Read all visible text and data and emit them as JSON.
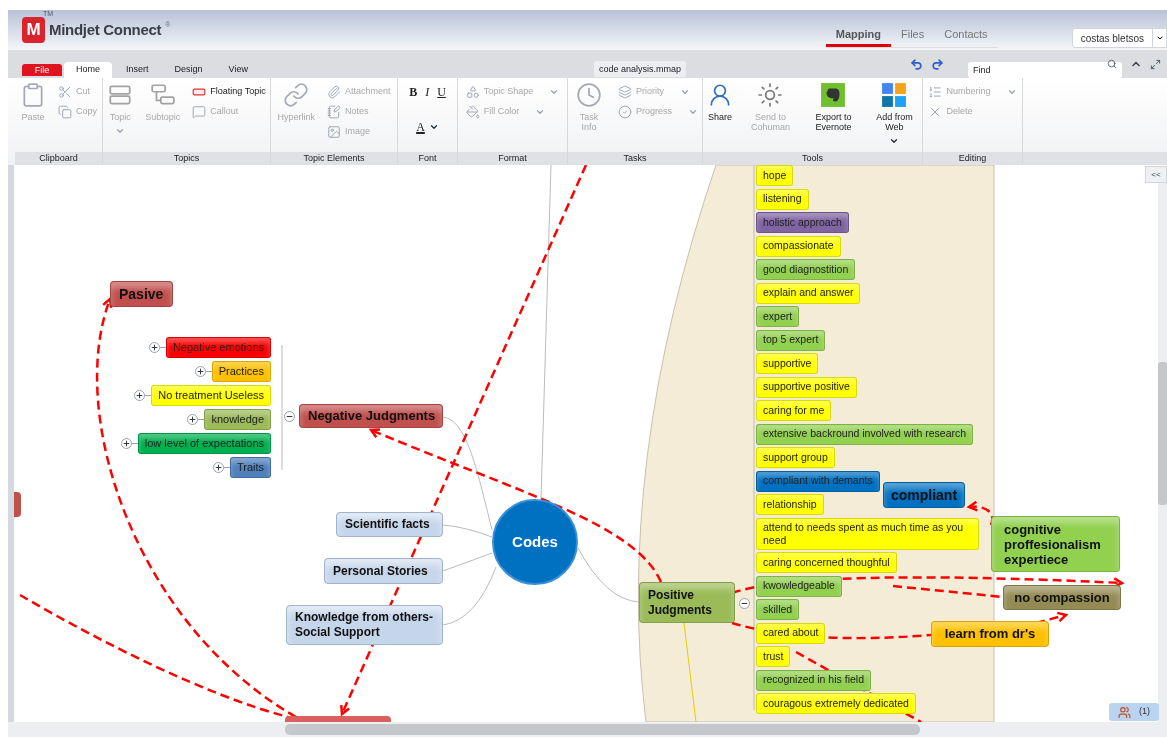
{
  "app": {
    "logo_mark": "M",
    "tm": "TM",
    "name": "Mindjet Connect",
    "registered": "®"
  },
  "nav_tabs": [
    {
      "label": "Mapping",
      "selected": true
    },
    {
      "label": "Files",
      "selected": false
    },
    {
      "label": "Contacts",
      "selected": false
    }
  ],
  "user": "costas bletsos",
  "ribbon_tabs": [
    {
      "label": "File",
      "kind": "file",
      "selected": false
    },
    {
      "label": "Home",
      "kind": "tab",
      "selected": true
    },
    {
      "label": "Insert",
      "kind": "tab",
      "selected": false
    },
    {
      "label": "Design",
      "kind": "tab",
      "selected": false
    },
    {
      "label": "View",
      "kind": "tab",
      "selected": false
    }
  ],
  "document_tab": "code analysis.mmap",
  "find": {
    "placeholder": "Find"
  },
  "ribbon_groups": [
    {
      "label": "Clipboard",
      "tools": [
        {
          "label": "Paste",
          "kind": "large",
          "disabled": true,
          "dropdown": false
        },
        {
          "label": "Cut",
          "kind": "small",
          "disabled": true,
          "dropdown": false
        },
        {
          "label": "Copy",
          "kind": "small",
          "disabled": true,
          "dropdown": false
        }
      ]
    },
    {
      "label": "Topics",
      "tools": [
        {
          "label": "Topic",
          "kind": "large",
          "disabled": true,
          "dropdown": true
        },
        {
          "label": "Subtopic",
          "kind": "large",
          "disabled": true,
          "dropdown": false
        },
        {
          "label": "Floating Topic",
          "kind": "small",
          "disabled": false,
          "dropdown": false
        },
        {
          "label": "Callout",
          "kind": "small",
          "disabled": true,
          "dropdown": false
        }
      ]
    },
    {
      "label": "Topic Elements",
      "tools": [
        {
          "label": "Hyperlink",
          "kind": "large",
          "disabled": true,
          "dropdown": false
        },
        {
          "label": "Attachment",
          "kind": "small",
          "disabled": true,
          "dropdown": false
        },
        {
          "label": "Notes",
          "kind": "small",
          "disabled": true,
          "dropdown": false
        },
        {
          "label": "Image",
          "kind": "small",
          "disabled": true,
          "dropdown": false
        }
      ]
    },
    {
      "label": "Font",
      "tools": [
        {
          "label": "B",
          "kind": "bold",
          "disabled": false,
          "dropdown": false
        },
        {
          "label": "I",
          "kind": "italic",
          "disabled": false,
          "dropdown": false
        },
        {
          "label": "U",
          "kind": "underline",
          "disabled": false,
          "dropdown": false
        },
        {
          "label": "A",
          "kind": "text_color",
          "disabled": false,
          "dropdown": true
        }
      ]
    },
    {
      "label": "Format",
      "tools": [
        {
          "label": "Topic Shape",
          "kind": "small",
          "disabled": true,
          "dropdown": true
        },
        {
          "label": "Fill Color",
          "kind": "small",
          "disabled": true,
          "dropdown": true
        }
      ]
    },
    {
      "label": "Tasks",
      "tools": [
        {
          "label": "Task Info",
          "kind": "large",
          "disabled": true,
          "dropdown": false
        },
        {
          "label": "Priority",
          "kind": "small",
          "disabled": true,
          "dropdown": true
        },
        {
          "label": "Progress",
          "kind": "small",
          "disabled": true,
          "dropdown": true
        }
      ]
    },
    {
      "label": "Tools",
      "tools": [
        {
          "label": "Share",
          "kind": "large",
          "disabled": false,
          "dropdown": false
        },
        {
          "label": "Send to Cohuman",
          "kind": "large",
          "disabled": true,
          "dropdown": false
        },
        {
          "label": "Export to Evernote",
          "kind": "large",
          "disabled": false,
          "dropdown": false
        },
        {
          "label": "Add from Web",
          "kind": "large",
          "disabled": false,
          "dropdown": true
        }
      ]
    },
    {
      "label": "Editing",
      "tools": [
        {
          "label": "Numbering",
          "kind": "small",
          "disabled": true,
          "dropdown": true
        },
        {
          "label": "Delete",
          "kind": "small",
          "disabled": true,
          "dropdown": false
        }
      ]
    }
  ],
  "collapse_button": "<<",
  "map": {
    "central_topic": "Codes",
    "negative": {
      "label": "Negative Judgments",
      "color": "#c0504d",
      "expanded": true,
      "children": [
        {
          "label": "Negative emotions",
          "color": "#ff0000",
          "expanded": false
        },
        {
          "label": "Practices",
          "color": "#ffc000",
          "expanded": false
        },
        {
          "label": "No treatment Useless",
          "color": "#ffff00",
          "expanded": false
        },
        {
          "label": "knowledge",
          "color": "#9bbb59",
          "expanded": false
        },
        {
          "label": "low level of expectations",
          "color": "#00b050",
          "expanded": false
        },
        {
          "label": "Traits",
          "color": "#4f81bd",
          "expanded": false
        }
      ]
    },
    "branches": [
      {
        "label": "Scientific facts"
      },
      {
        "label": "Personal Stories"
      },
      {
        "label": "Knowledge from others-Social Support"
      }
    ],
    "positive": {
      "label": "Positive Judgments",
      "color": "#9bbb59",
      "expanded": true,
      "children": [
        {
          "label": "hope",
          "color": "#ffff00"
        },
        {
          "label": "listening",
          "color": "#ffff00"
        },
        {
          "label": "holistic approach",
          "color": "#8064a2"
        },
        {
          "label": "compassionate",
          "color": "#ffff00"
        },
        {
          "label": "good diagnostition",
          "color": "#92d050"
        },
        {
          "label": "explain and answer",
          "color": "#ffff00"
        },
        {
          "label": "expert",
          "color": "#92d050"
        },
        {
          "label": "top 5 expert",
          "color": "#92d050"
        },
        {
          "label": "supportive",
          "color": "#ffff00"
        },
        {
          "label": "supportive positive",
          "color": "#ffff00"
        },
        {
          "label": "caring for me",
          "color": "#ffff00"
        },
        {
          "label": "extensive backround involved with research",
          "color": "#92d050"
        },
        {
          "label": "support group",
          "color": "#ffff00"
        },
        {
          "label": "compliant with demants",
          "color": "#0070c0"
        },
        {
          "label": "relationship",
          "color": "#ffff00"
        },
        {
          "label": "attend to needs spent as much time as you need",
          "color": "#ffff00"
        },
        {
          "label": "caring concerned thoughful",
          "color": "#ffff00"
        },
        {
          "label": "kwowledgeable",
          "color": "#92d050"
        },
        {
          "label": "skilled",
          "color": "#92d050"
        },
        {
          "label": "cared about",
          "color": "#ffff00"
        },
        {
          "label": "trust",
          "color": "#ffff00"
        },
        {
          "label": "recognized in his field",
          "color": "#92d050"
        },
        {
          "label": "couragous extremely dedicated",
          "color": "#ffff00"
        }
      ]
    },
    "floating": [
      {
        "label": "Pasive",
        "color": "#c0504d"
      },
      {
        "label": "compliant",
        "color": "#0070c0"
      },
      {
        "label": "cognitive proffesionalism expertiece",
        "color": "#92d050"
      },
      {
        "label": "no compassion",
        "color": "#948a54"
      },
      {
        "label": "learn from dr's",
        "color": "#ffc000"
      }
    ]
  },
  "collaborators": "(1)"
}
